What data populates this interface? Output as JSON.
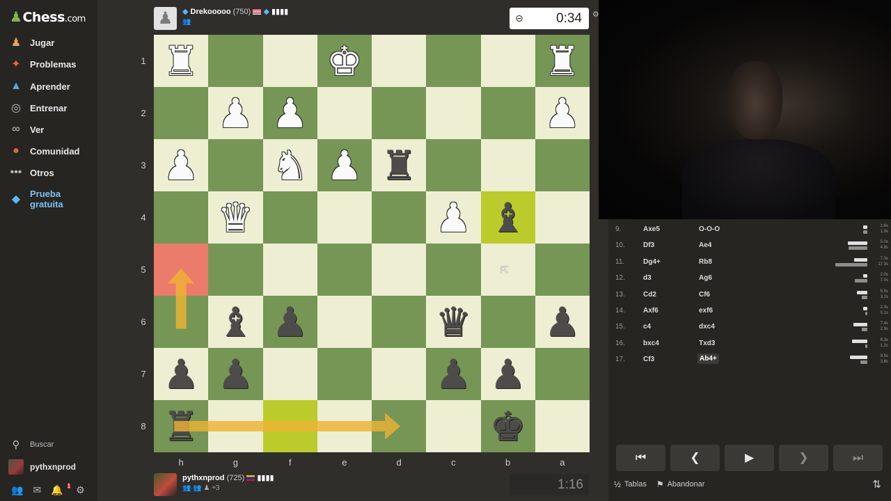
{
  "sidebar": {
    "logo": "Chess",
    "logo_suffix": ".com",
    "items": [
      {
        "label": "Jugar",
        "icon": "pawn-hand-icon"
      },
      {
        "label": "Problemas",
        "icon": "puzzle-icon"
      },
      {
        "label": "Aprender",
        "icon": "graduation-cap-icon"
      },
      {
        "label": "Entrenar",
        "icon": "target-icon"
      },
      {
        "label": "Ver",
        "icon": "binoculars-icon"
      },
      {
        "label": "Comunidad",
        "icon": "community-icon"
      },
      {
        "label": "Otros",
        "icon": "more-dots-icon"
      },
      {
        "label": "Prueba gratuita",
        "icon": "diamond-icon"
      }
    ],
    "search_label": "Buscar",
    "username": "pythxnprod",
    "notifications_count": "1"
  },
  "top_player": {
    "name": "Drekooooo",
    "rating": "(750)",
    "clock": "0:34"
  },
  "bottom_player": {
    "name": "pythxnprod",
    "rating": "(725)",
    "extra": "+3",
    "clock": "1:16"
  },
  "board": {
    "ranks": [
      "1",
      "2",
      "3",
      "4",
      "5",
      "6",
      "7",
      "8"
    ],
    "files": [
      "h",
      "g",
      "f",
      "e",
      "d",
      "c",
      "b",
      "a"
    ],
    "light_color": "#eeeed2",
    "dark_color": "#769656",
    "highlight_red": "#eb7b6a",
    "highlight_yellow": "#bbcb2b",
    "arrow_color": "#f0b334",
    "pieces": [
      {
        "square": "h1",
        "piece": "♜",
        "color": "w",
        "name": "white-rook"
      },
      {
        "square": "e1",
        "piece": "♚",
        "color": "w",
        "name": "white-king"
      },
      {
        "square": "a1",
        "piece": "♜",
        "color": "w",
        "name": "white-rook"
      },
      {
        "square": "g2",
        "piece": "♟",
        "color": "w",
        "name": "white-pawn"
      },
      {
        "square": "f2",
        "piece": "♟",
        "color": "w",
        "name": "white-pawn"
      },
      {
        "square": "a2",
        "piece": "♟",
        "color": "w",
        "name": "white-pawn"
      },
      {
        "square": "h3",
        "piece": "♟",
        "color": "w",
        "name": "white-pawn"
      },
      {
        "square": "f3",
        "piece": "♞",
        "color": "w",
        "name": "white-knight"
      },
      {
        "square": "e3",
        "piece": "♟",
        "color": "w",
        "name": "white-pawn"
      },
      {
        "square": "d3",
        "piece": "♜",
        "color": "b",
        "name": "black-rook"
      },
      {
        "square": "g4",
        "piece": "♛",
        "color": "w",
        "name": "white-queen"
      },
      {
        "square": "c4",
        "piece": "♟",
        "color": "w",
        "name": "white-pawn"
      },
      {
        "square": "b4",
        "piece": "♝",
        "color": "b",
        "name": "black-bishop"
      },
      {
        "square": "g6",
        "piece": "♝",
        "color": "b",
        "name": "black-bishop"
      },
      {
        "square": "f6",
        "piece": "♟",
        "color": "b",
        "name": "black-pawn"
      },
      {
        "square": "c6",
        "piece": "♛",
        "color": "b",
        "name": "black-queen"
      },
      {
        "square": "a6",
        "piece": "♟",
        "color": "b",
        "name": "black-pawn"
      },
      {
        "square": "h7",
        "piece": "♟",
        "color": "b",
        "name": "black-pawn"
      },
      {
        "square": "g7",
        "piece": "♟",
        "color": "b",
        "name": "black-pawn"
      },
      {
        "square": "c7",
        "piece": "♟",
        "color": "b",
        "name": "black-pawn"
      },
      {
        "square": "b7",
        "piece": "♟",
        "color": "b",
        "name": "black-pawn"
      },
      {
        "square": "h8",
        "piece": "♜",
        "color": "b",
        "name": "black-rook"
      },
      {
        "square": "b8",
        "piece": "♚",
        "color": "b",
        "name": "black-king"
      }
    ],
    "highlights": [
      {
        "square": "h5",
        "type": "red"
      },
      {
        "square": "b4",
        "type": "yellow"
      },
      {
        "square": "f8",
        "type": "yellow"
      }
    ],
    "arrows": [
      {
        "from": "h6",
        "to": "h5"
      },
      {
        "from": "h8",
        "to": "d8"
      }
    ]
  },
  "moves": [
    {
      "num": "9.",
      "white": "Axe5",
      "black": "O-O-O",
      "wt": "1.6s",
      "bt": "1.9s",
      "wf": 0.12,
      "bf": 0.14
    },
    {
      "num": "10.",
      "white": "Df3",
      "black": "Ae4",
      "wt": "5.0s",
      "bt": "4.9s",
      "wf": 0.6,
      "bf": 0.58
    },
    {
      "num": "11.",
      "white": "Dg4+",
      "black": "Rb8",
      "wt": "7.3s",
      "bt": "17.3s",
      "wf": 0.42,
      "bf": 1.0
    },
    {
      "num": "12.",
      "white": "d3",
      "black": "Ag6",
      "wt": "2.0s",
      "bt": "7.0s",
      "wf": 0.12,
      "bf": 0.4
    },
    {
      "num": "13.",
      "white": "Cd2",
      "black": "Cf6",
      "wt": "5.5s",
      "bt": "3.2s",
      "wf": 0.32,
      "bf": 0.18
    },
    {
      "num": "14.",
      "white": "Axf6",
      "black": "exf6",
      "wt": "2.3s",
      "bt": "0.1s",
      "wf": 0.13,
      "bf": 0.02
    },
    {
      "num": "15.",
      "white": "c4",
      "black": "dxc4",
      "wt": "7.4s",
      "bt": "2.9s",
      "wf": 0.43,
      "bf": 0.17
    },
    {
      "num": "16.",
      "white": "bxc4",
      "black": "Txd3",
      "wt": "8.3s",
      "bt": "1.2s",
      "wf": 0.48,
      "bf": 0.07
    },
    {
      "num": "17.",
      "white": "Cf3",
      "black": "Ab4+",
      "wt": "9.5s",
      "bt": "3.8s",
      "wf": 0.55,
      "bf": 0.22,
      "current": true
    }
  ],
  "controls": {
    "first": "⏮",
    "prev": "❮",
    "play": "▶",
    "next": "❯",
    "last": "⏭"
  },
  "actions": {
    "draw_icon": "½",
    "draw_label": "Tablas",
    "resign_label": "Abandonar"
  }
}
